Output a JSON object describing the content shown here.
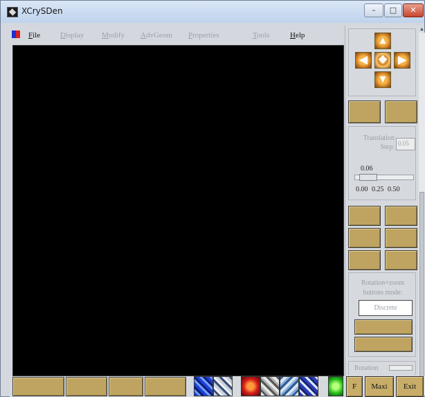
{
  "window": {
    "title": "XCrySDen",
    "minimize_glyph": "–",
    "maximize_glyph": "□",
    "close_glyph": "✕"
  },
  "menu": [
    {
      "label": "File",
      "enabled": true
    },
    {
      "label": "Display",
      "enabled": false
    },
    {
      "label": "Modify",
      "enabled": false
    },
    {
      "label": "AdvGeom",
      "enabled": false
    },
    {
      "label": "Properties",
      "enabled": false
    },
    {
      "label": "Tools",
      "enabled": false
    },
    {
      "label": "Help",
      "enabled": true
    }
  ],
  "navigation": {
    "up": "▲",
    "left": "◀",
    "center": "✥",
    "right": "▶",
    "down": "▼"
  },
  "translation": {
    "label": "Translation Step:",
    "input_value": "0.05",
    "value": "0.06",
    "slider_fraction": 0.12,
    "ticks": [
      "0.00",
      "0.25",
      "0.50"
    ]
  },
  "rotation": {
    "label": "Rotation+zoom buttons mode:",
    "mode_button": "Discrete",
    "label2": "Rotation"
  },
  "bottom": {
    "buttons": [
      "F",
      "Maxi",
      "Exit"
    ]
  },
  "colors": {
    "button_gold": "#bfa461",
    "canvas": "#000000",
    "arrow_orange": "#e8902a"
  }
}
